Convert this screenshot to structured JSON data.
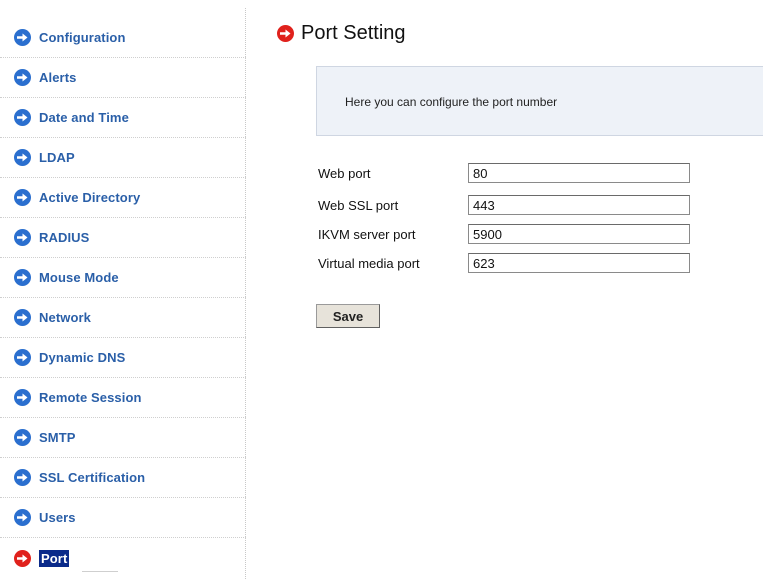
{
  "sidebar": {
    "items": [
      {
        "label": "Configuration",
        "icon": "arrow-right-circle-icon"
      },
      {
        "label": "Alerts",
        "icon": "arrow-right-circle-icon"
      },
      {
        "label": "Date and Time",
        "icon": "arrow-right-circle-icon"
      },
      {
        "label": "LDAP",
        "icon": "arrow-right-circle-icon"
      },
      {
        "label": "Active Directory",
        "icon": "arrow-right-circle-icon"
      },
      {
        "label": "RADIUS",
        "icon": "arrow-right-circle-icon"
      },
      {
        "label": "Mouse Mode",
        "icon": "arrow-right-circle-icon"
      },
      {
        "label": "Network",
        "icon": "arrow-right-circle-icon"
      },
      {
        "label": "Dynamic DNS",
        "icon": "arrow-right-circle-icon"
      },
      {
        "label": "Remote Session",
        "icon": "arrow-right-circle-icon"
      },
      {
        "label": "SMTP",
        "icon": "arrow-right-circle-icon"
      },
      {
        "label": "SSL Certification",
        "icon": "arrow-right-circle-icon"
      },
      {
        "label": "Users",
        "icon": "arrow-right-circle-icon"
      },
      {
        "label": "Port",
        "icon": "arrow-right-circle-icon",
        "active": true
      }
    ],
    "icon_color": "#2a6fcf",
    "active_icon_color": "#e0211c",
    "active_highlight_color": "#0a2a8a"
  },
  "main": {
    "title": "Port Setting",
    "title_icon": "arrow-right-circle-icon",
    "info_text": "Here you can configure the port number",
    "fields": [
      {
        "label": "Web port",
        "value": "80"
      },
      {
        "label": "Web SSL port",
        "value": "443"
      },
      {
        "label": "IKVM server port",
        "value": "5900"
      },
      {
        "label": "Virtual media port",
        "value": "623"
      }
    ],
    "save_label": "Save"
  }
}
